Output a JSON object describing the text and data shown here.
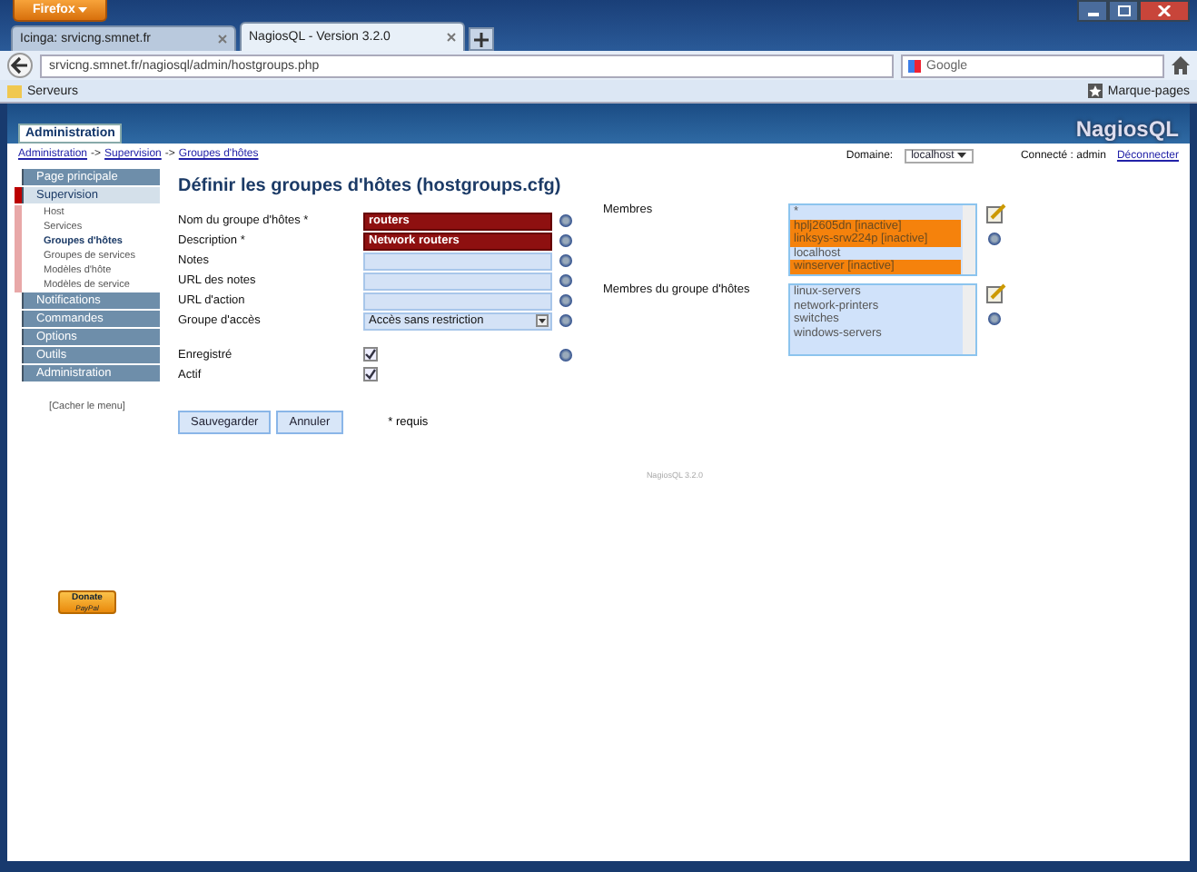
{
  "browser": {
    "menu_button": "Firefox",
    "tabs": [
      {
        "title": "Icinga: srvicng.smnet.fr",
        "selected": false
      },
      {
        "title": "NagiosQL - Version 3.2.0",
        "selected": true
      }
    ],
    "url": "srvicng.smnet.fr/nagiosql/admin/hostgroups.php",
    "search_placeholder": "Google",
    "bookmarks": [
      "Serveurs"
    ],
    "bookmarks_menu": "Marque-pages"
  },
  "header": {
    "tab": "Administration",
    "logo": "NagiosQL"
  },
  "topbar": {
    "breadcrumb": [
      "Administration",
      "Supervision",
      "Groupes d'hôtes"
    ],
    "separator": "->",
    "domain_label": "Domaine:",
    "domain_value": "localhost",
    "connected": "Connecté : admin",
    "logout": "Déconnecter"
  },
  "sidebar": {
    "items": [
      {
        "label": "Page principale",
        "selected": false
      },
      {
        "label": "Supervision",
        "selected": true,
        "children": [
          {
            "label": "Host",
            "selected": false
          },
          {
            "label": "Services",
            "selected": false
          },
          {
            "label": "Groupes d'hôtes",
            "selected": true
          },
          {
            "label": "Groupes de services",
            "selected": false
          },
          {
            "label": "Modèles d'hôte",
            "selected": false
          },
          {
            "label": "Modèles de service",
            "selected": false
          }
        ]
      },
      {
        "label": "Notifications",
        "selected": false
      },
      {
        "label": "Commandes",
        "selected": false
      },
      {
        "label": "Options",
        "selected": false
      },
      {
        "label": "Outils",
        "selected": false
      },
      {
        "label": "Administration",
        "selected": false
      }
    ],
    "hide_menu": "[Cacher le menu]",
    "donate": {
      "label": "Donate",
      "sub": "PayPal"
    }
  },
  "form": {
    "title": "Définir les groupes d'hôtes (hostgroups.cfg)",
    "fields": [
      {
        "kind": "text",
        "label": "Nom du groupe d'hôtes *",
        "value": "routers",
        "required": true,
        "help": true
      },
      {
        "kind": "text",
        "label": "Description *",
        "value": "Network routers",
        "required": true,
        "help": true
      },
      {
        "kind": "text",
        "label": "Notes",
        "required": false,
        "help": true
      },
      {
        "kind": "text",
        "label": "URL des notes",
        "required": false,
        "help": true
      },
      {
        "kind": "text",
        "label": "URL d'action",
        "required": false,
        "help": true
      },
      {
        "kind": "select",
        "label": "Groupe d'accès",
        "value": "Accès sans restriction",
        "required": false,
        "help": true
      },
      {
        "kind": "checkbox",
        "label": "Enregistré",
        "checked": true,
        "help": true
      },
      {
        "kind": "checkbox",
        "label": "Actif",
        "checked": true,
        "help": false
      }
    ],
    "lists": [
      {
        "label": "Membres",
        "items": [
          {
            "text": "*",
            "selected": false
          },
          {
            "text": "hplj2605dn [inactive]",
            "selected": true
          },
          {
            "text": "linksys-srw224p [inactive]",
            "selected": true
          },
          {
            "text": "localhost",
            "selected": false
          },
          {
            "text": "winserver [inactive]",
            "selected": true
          }
        ]
      },
      {
        "label": "Membres du groupe d'hôtes",
        "items": [
          {
            "text": "linux-servers",
            "selected": false
          },
          {
            "text": "network-printers",
            "selected": false
          },
          {
            "text": "switches",
            "selected": false
          },
          {
            "text": "windows-servers",
            "selected": false
          }
        ]
      }
    ],
    "buttons": [
      "Sauvegarder",
      "Annuler"
    ],
    "required_note": "* requis"
  },
  "footer": "NagiosQL 3.2.0"
}
